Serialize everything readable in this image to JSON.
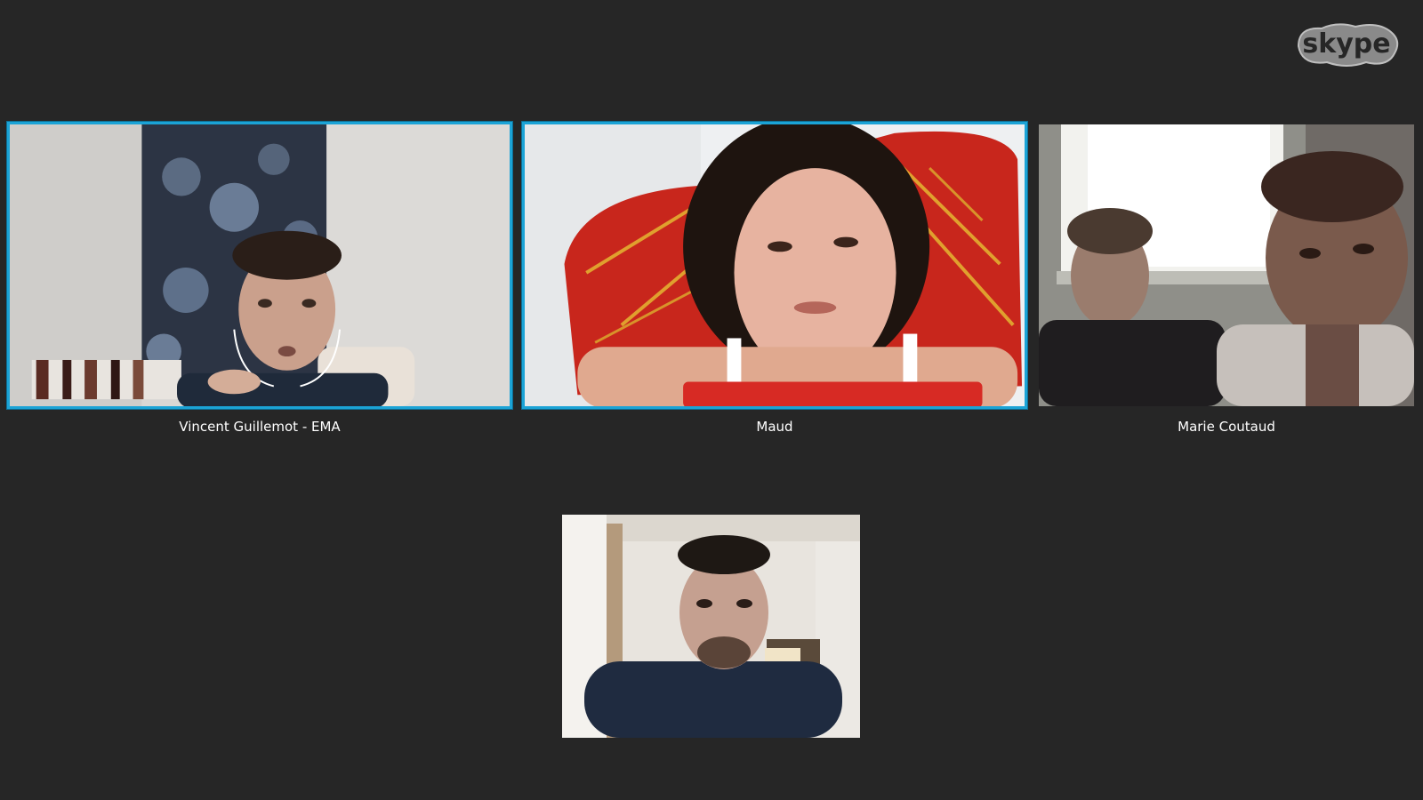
{
  "app": {
    "name": "Skype",
    "logo_icon": "skype-logo-icon",
    "background": "#262626",
    "active_border": "#1ba3d6"
  },
  "logo_text": "skype",
  "participants": [
    {
      "name": "Vincent Guillemot - EMA",
      "active": true
    },
    {
      "name": "Maud",
      "active": true
    },
    {
      "name": "Marie Coutaud",
      "active": false
    }
  ],
  "self_view": {
    "label": ""
  }
}
